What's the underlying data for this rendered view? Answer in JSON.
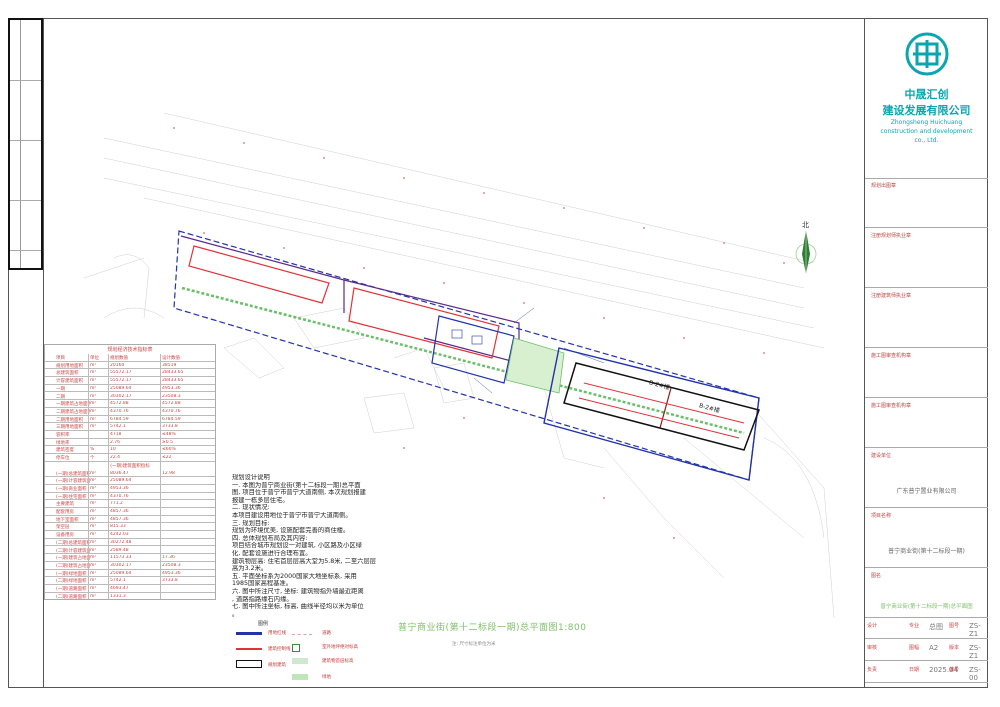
{
  "company": {
    "name_line1": "中晟汇创",
    "name_line2": "建设发展有限公司",
    "name_en": "Zhongsheng Huichuang construction and development co., Ltd.",
    "brand_color": "#0aa6b0"
  },
  "right_panel": {
    "rows": [
      {
        "label": "规划出图章",
        "value": ""
      },
      {
        "label": "注册规划师执业章",
        "value": ""
      },
      {
        "label": "注册建筑师执业章",
        "value": ""
      },
      {
        "label": "施工图审查机构章",
        "value": ""
      },
      {
        "label": "施工图审查机构章",
        "value": ""
      },
      {
        "label": "建设单位",
        "value": "广东普宁置业有限公司"
      },
      {
        "label": "项目名称",
        "value": "普宁商业街(第十二标段一期)"
      }
    ],
    "drawing_name_label": "图名",
    "drawing_name": "普宁商业街(第十二标段一期)总平面图"
  },
  "title_block": {
    "cells": [
      {
        "k": "设计",
        "v": "",
        "k2": "专业",
        "v2": "总图",
        "k3": "图号",
        "v3": "ZS-Z1"
      },
      {
        "k": "审核",
        "v": "",
        "k2": "图幅",
        "v2": "A2",
        "k3": "版本",
        "v3": "ZS-Z1"
      },
      {
        "k": "负责",
        "v": "",
        "k2": "日期",
        "v2": "2025.04",
        "k3": "编号",
        "v3": "ZS-00"
      }
    ]
  },
  "econ_table": {
    "title": "规划经济技术指标表",
    "rows": [
      [
        "项目",
        "单位",
        "规划数值",
        "设计数值"
      ],
      [
        "规划用地面积",
        "m²",
        "20160",
        "38519"
      ],
      [
        "总建筑面积",
        "m²",
        "55572.17",
        "28433.65"
      ],
      [
        "计容建筑面积",
        "m²",
        "55572.17",
        "28433.65"
      ],
      [
        "一期",
        "m²",
        "25089.64",
        "4953.36"
      ],
      [
        "二期",
        "m²",
        "30302.17",
        "23508.3"
      ],
      [
        "一期建筑占地面积",
        "m²",
        "4572.88",
        "4572.88"
      ],
      [
        "二期建筑占地面积",
        "m²",
        "4370.76",
        "4370.76"
      ],
      [
        "二期用地面积",
        "m²",
        "6784.59",
        "6784.59"
      ],
      [
        "三期用地面积",
        "m²",
        "5742.1",
        "3733.8"
      ],
      [
        "容积率",
        "",
        "4718",
        "≤48%"
      ],
      [
        "绿地率",
        "",
        "2.76",
        "≥0.5"
      ],
      [
        "建筑密度",
        "%",
        "10",
        "≤60%"
      ],
      [
        "停车位",
        "个",
        "22.4",
        "≤22"
      ]
    ],
    "sub_title": "(一期)建筑面积指标",
    "sub_rows": [
      [
        "(一期)总建筑面积",
        "m²",
        "8036.47",
        "12.98"
      ],
      [
        "(一期)计容建筑面积",
        "m²",
        "25089.64",
        ""
      ],
      [
        "(一期)商业面积",
        "m²",
        "4953.36",
        ""
      ],
      [
        "(一期)住宅面积",
        "m²",
        "4370.76",
        ""
      ],
      [
        "主要建筑",
        "m²",
        "771.2",
        ""
      ],
      [
        "配套用房",
        "m²",
        "4857.36",
        ""
      ],
      [
        "地下室面积",
        "m²",
        "4857.36",
        ""
      ],
      [
        "架空层",
        "m²",
        "815.33",
        ""
      ],
      [
        "设备用房",
        "m²",
        "4242.03",
        ""
      ],
      [
        "(二期)总建筑面积",
        "m²",
        "30272.48",
        ""
      ],
      [
        "(二期)计容建筑面积",
        "m²",
        "2589.48",
        ""
      ]
    ],
    "sub2_rows": [
      [
        "(一期)建筑占地面积",
        "m²",
        "11573.33",
        "17.36"
      ],
      [
        "(二期)建筑占地面积",
        "m²",
        "30302.17",
        "23508.3"
      ],
      [
        "(一期)绿地面积",
        "m²",
        "25089.64",
        "4953.36"
      ],
      [
        "(二期)绿地面积",
        "m²",
        "5742.1",
        "3733.8"
      ],
      [
        "(一期)道路面积",
        "m²",
        "4693.47",
        ""
      ],
      [
        "(二期)道路面积",
        "m²",
        "1331.3",
        ""
      ]
    ]
  },
  "notes": {
    "lines": [
      "规划设计说明",
      "一. 本图为普宁商业街(第十二标段一期)总平面",
      "图, 项目位于普宁市普宁大道南侧, 本次规划报建",
      "报建一栋多层住宅。",
      "二. 现状情况:",
      "本项目建设用地位于普宁市普宁大道南侧。",
      "三. 规划目标:",
      "规划为环境优美, 设施配套完善的商住楼。",
      "四. 总体规划布局及其内容:",
      "项目结合城市规划设一对建筑, 小区路及小区绿",
      "化, 配套设施进行合理布置。",
      "建筑物层高: 住宅首层层高大堂为5.8米, 二至六层层",
      "高为3.2米。",
      "五. 平面坐标系为2000国家大地坐标系, 采用",
      "1985国家高程基准。",
      "六. 图中所注尺寸, 坐标: 建筑物指外墙最近距离",
      ", 道路指路缘石内缘。",
      "七. 图中所注坐标, 标高, 曲线半径均以米为单位",
      "。"
    ]
  },
  "drawing": {
    "title": "普宁商业街(第十二标段一期)总平面图1:800",
    "subtitle": "注: 尺寸标注单位为米",
    "north_label": "北",
    "block_labels": [
      "B-2#楼",
      "B-2#楼"
    ]
  },
  "legend": {
    "title": "图例",
    "items": [
      {
        "label": "用地红线",
        "color": "#2233aa"
      },
      {
        "label": "建筑控制线",
        "color": "#e0333a"
      },
      {
        "label": "规划建筑",
        "color": "#111111"
      },
      {
        "label": "道路",
        "color": "#e0a0a0"
      },
      {
        "label": "室外地坪绝对标高",
        "color": "#3a8a3a"
      },
      {
        "label": "建筑物首层标高",
        "color": "#3a8a3a"
      },
      {
        "label": "绿地",
        "color": "#6bbf6b"
      }
    ]
  }
}
